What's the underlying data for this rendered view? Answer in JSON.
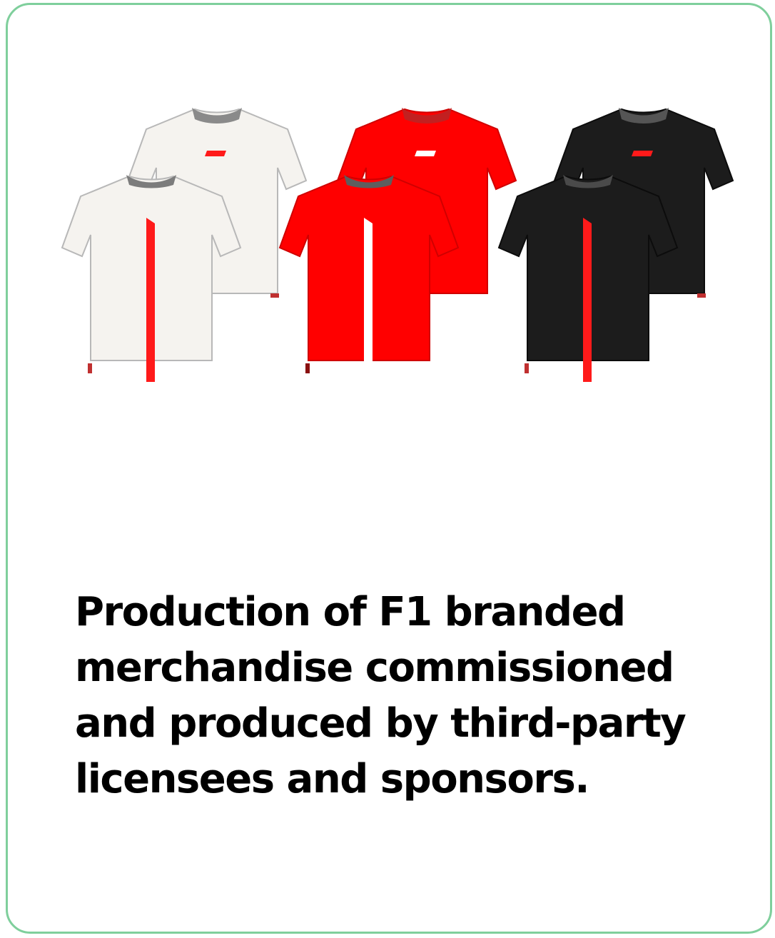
{
  "caption": "Production of F1 branded merchandise commissioned and produced by third-party licensees and sponsors.",
  "colors": {
    "card_border": "#7fcf9c",
    "white_tee": "#f5f3ef",
    "red_tee": "#ff0000",
    "black_tee": "#1c1c1c",
    "stripe_red": "#ff1a1a",
    "text": "#000000"
  },
  "shirts": [
    {
      "color": "white",
      "view": "front"
    },
    {
      "color": "white",
      "view": "back"
    },
    {
      "color": "red",
      "view": "front"
    },
    {
      "color": "red",
      "view": "back"
    },
    {
      "color": "black",
      "view": "front"
    },
    {
      "color": "black",
      "view": "back"
    }
  ]
}
